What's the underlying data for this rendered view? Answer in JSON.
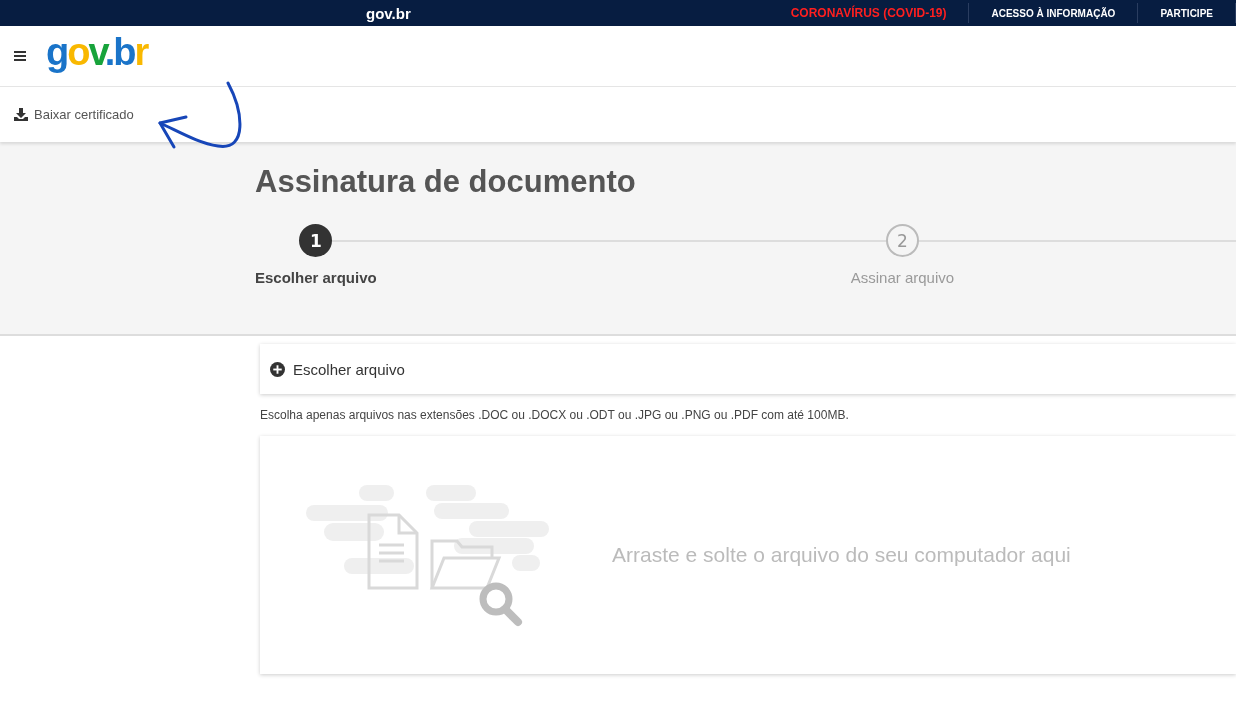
{
  "top_bar": {
    "logo": "gov.br",
    "links": [
      {
        "label": "CORONAVÍRUS (COVID-19)",
        "kind": "alert"
      },
      {
        "label": "ACESSO À INFORMAÇÃO",
        "kind": "normal"
      },
      {
        "label": "PARTICIPE",
        "kind": "normal"
      }
    ]
  },
  "header": {
    "logo": [
      {
        "text": "g",
        "color": "#1a74c9"
      },
      {
        "text": "o",
        "color": "#f9b800"
      },
      {
        "text": "v",
        "color": "#17a33b"
      },
      {
        "text": ".",
        "color": "#1a74c9"
      },
      {
        "text": "b",
        "color": "#1a74c9"
      },
      {
        "text": "r",
        "color": "#f9b800"
      }
    ]
  },
  "toolbar": {
    "download_link": "Baixar certificado"
  },
  "page": {
    "title": "Assinatura de documento",
    "steps": [
      {
        "number": "1",
        "label": "Escolher arquivo",
        "selected": true
      },
      {
        "number": "2",
        "label": "Assinar arquivo",
        "selected": false
      }
    ],
    "file_button": "Escolher arquivo",
    "hint": "Escolha apenas arquivos nas extensões .DOC ou .DOCX ou .ODT ou .JPG ou .PNG ou .PDF com até 100MB.",
    "dropzone": "Arraste e solte o arquivo do seu computador aqui"
  }
}
